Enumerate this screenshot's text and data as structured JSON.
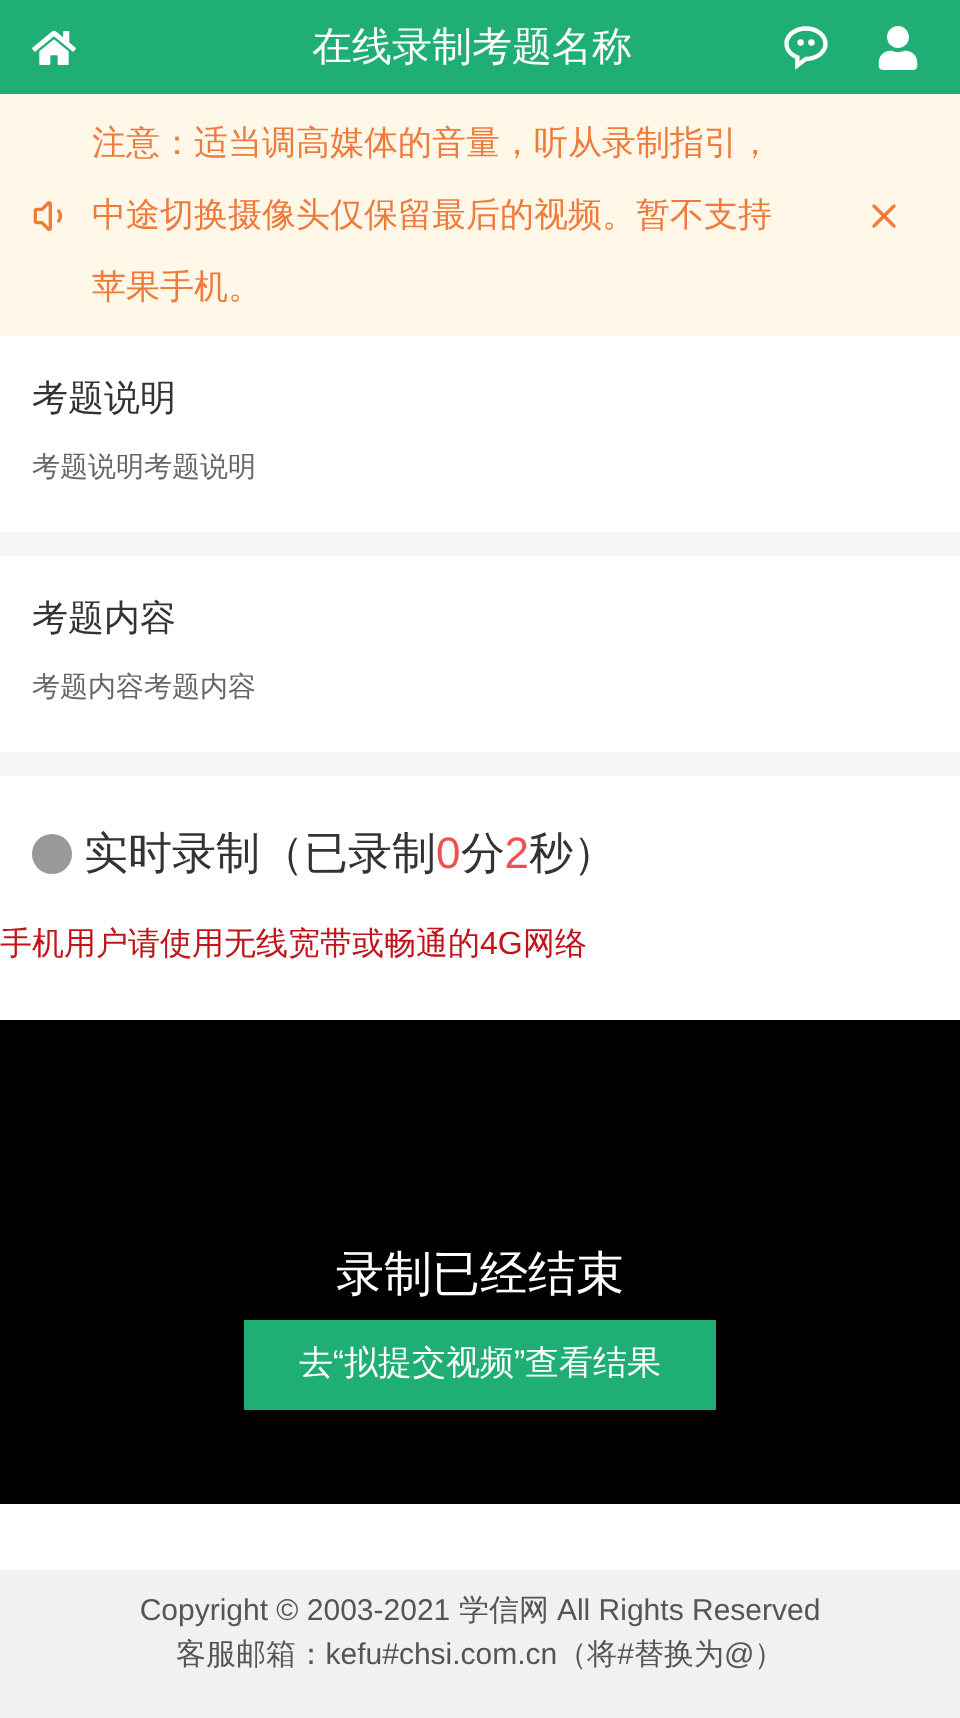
{
  "header": {
    "title": "在线录制考题名称"
  },
  "notice": {
    "text": "注意：适当调高媒体的音量，听从录制指引，中途切换摄像头仅保留最后的视频。暂不支持苹果手机。"
  },
  "sections": [
    {
      "title": "考题说明",
      "body": "考题说明考题说明"
    },
    {
      "title": "考题内容",
      "body": "考题内容考题内容"
    }
  ],
  "recording": {
    "active": false,
    "title_parts": [
      {
        "text": "实时录制（已录制",
        "highlight": false
      },
      {
        "text": "0",
        "highlight": true
      },
      {
        "text": "分",
        "highlight": false
      },
      {
        "text": "2",
        "highlight": true
      },
      {
        "text": "秒）",
        "highlight": false
      }
    ],
    "warning": "手机用户请使用无线宽带或畅通的4G网络"
  },
  "video": {
    "message": "录制已经结束",
    "button": "去“拟提交视频”查看结果"
  },
  "footer": [
    "Copyright © 2003-2021 学信网 All Rights Reserved",
    "客服邮箱：kefu#chsi.com.cn（将#替换为@）"
  ]
}
